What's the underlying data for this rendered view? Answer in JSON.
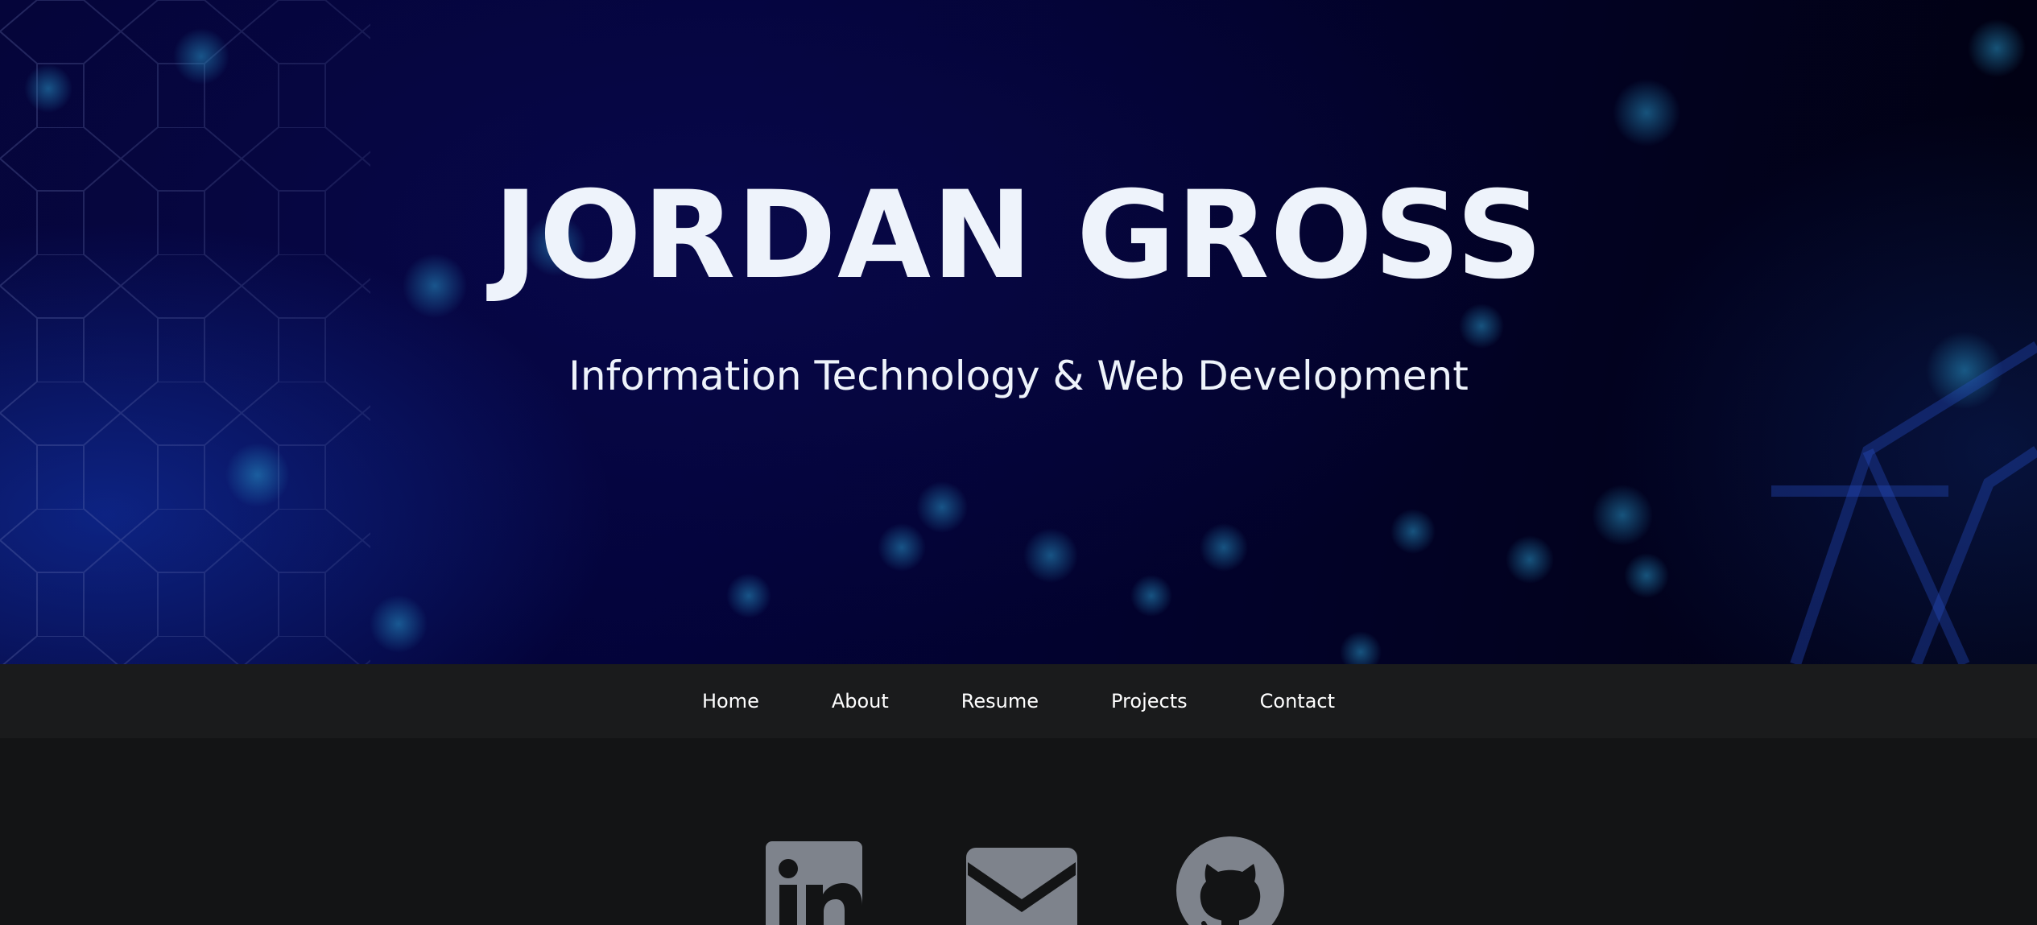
{
  "hero": {
    "title": "JORDAN GROSS",
    "subtitle": "Information Technology & Web Development"
  },
  "nav": {
    "items": [
      {
        "label": "Home"
      },
      {
        "label": "About"
      },
      {
        "label": "Resume"
      },
      {
        "label": "Projects"
      },
      {
        "label": "Contact"
      }
    ]
  },
  "social": {
    "icons": [
      "linkedin-icon",
      "email-icon",
      "github-icon"
    ],
    "icon_color": "#7e838c"
  },
  "colors": {
    "hero_text": "#eef3fb",
    "nav_background": "#1a1b1c",
    "page_background": "#131415"
  }
}
